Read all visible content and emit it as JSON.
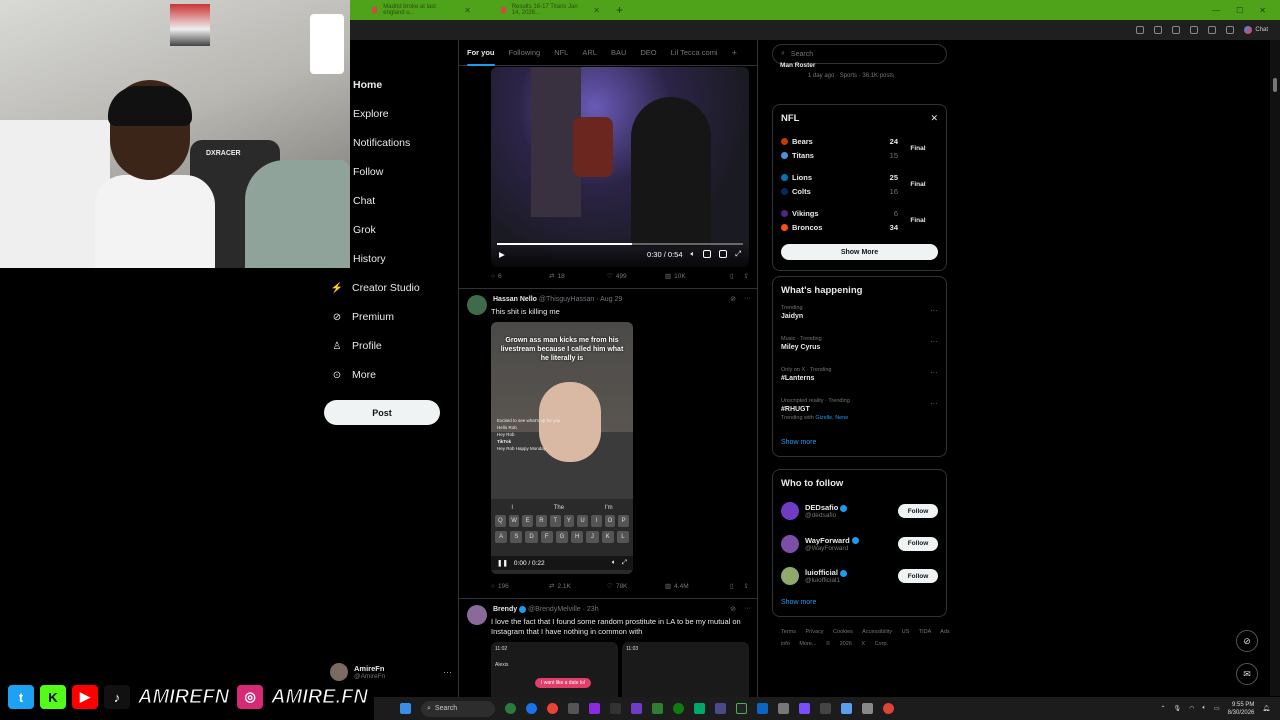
{
  "browser": {
    "tabs": [
      {
        "title": "Madrid broke at last england u..."
      },
      {
        "title": "Results 16-17 Titans Jan 14, 2026..."
      }
    ],
    "new_tab": "+",
    "toolbar_chat": "Chat"
  },
  "overlay": {
    "webcam_chair_text": "DXRACER",
    "social_handle_1": "AMIREFN",
    "social_handle_2": "AMIRE.FN"
  },
  "nav": {
    "items": [
      {
        "label": "Home",
        "icon": "home-icon"
      },
      {
        "label": "Explore",
        "icon": "explore-icon"
      },
      {
        "label": "Notifications",
        "icon": "bell-icon"
      },
      {
        "label": "Follow",
        "icon": "follow-icon"
      },
      {
        "label": "Chat",
        "icon": "chat-icon"
      },
      {
        "label": "Grok",
        "icon": "grok-icon"
      },
      {
        "label": "History",
        "icon": "history-icon"
      },
      {
        "label": "Creator Studio",
        "icon": "creator-studio-icon"
      },
      {
        "label": "Premium",
        "icon": "premium-icon"
      },
      {
        "label": "Profile",
        "icon": "profile-icon"
      },
      {
        "label": "More",
        "icon": "more-icon"
      }
    ],
    "post_button": "Post",
    "account": {
      "name": "AmireFn",
      "handle": "@AmireFn",
      "more": "···"
    }
  },
  "feed": {
    "tabs": [
      "For you",
      "Following",
      "NFL",
      "ARL",
      "BAU",
      "DEO",
      "Lil Tecca comi"
    ],
    "tabs_more": "+",
    "tweet1": {
      "video_time": "0:30 / 0:54",
      "progress": 0.55,
      "replies": "6",
      "reposts": "18",
      "likes": "499",
      "views": "10K"
    },
    "tweet2": {
      "name": "Hassan Nello",
      "handle": "@ThisguyHassan",
      "date": "Aug 29",
      "text": "This shit is killing me",
      "video_caption": "Grown ass man kicks me from his livestream because I called him what he literally is",
      "video_comments": [
        "Excited to see what's up for you",
        "Hello Rob",
        "Hey Rob",
        "TikTok",
        "Hey Rob Happy Monday"
      ],
      "keyboard_suggestions": [
        "I",
        "The",
        "I'm"
      ],
      "keyboard_row1": [
        "Q",
        "W",
        "E",
        "R",
        "T",
        "Y",
        "U",
        "I",
        "O",
        "P"
      ],
      "keyboard_row2": [
        "A",
        "S",
        "D",
        "F",
        "G",
        "H",
        "J",
        "K",
        "L"
      ],
      "video_time": "0:00 / 0:22",
      "replies": "196",
      "reposts": "2.1K",
      "likes": "78K",
      "views": "4.4M"
    },
    "tweet3": {
      "name": "Brendy",
      "handle": "@BrendyMelville",
      "date": "23h",
      "text": "I love the fact that I found some random prostitute in LA to be my mutual on Instagram that I have nothing in common with",
      "media_left_time": "11:02",
      "media_left_name": "Alexis",
      "media_left_pill": "I want like a date lol",
      "media_right_time": "11:03"
    }
  },
  "right": {
    "search_placeholder": "Search",
    "top_strip": {
      "title": "Man Roster",
      "meta": "1 day ago · Sports · 36.1K posts"
    },
    "nfl": {
      "title": "NFL",
      "close": "✕",
      "games": [
        {
          "home": "Bears",
          "home_score": "24",
          "away": "Titans",
          "away_score": "15",
          "status": "Final",
          "home_color": "#c83803",
          "away_color": "#4b92db"
        },
        {
          "home": "Lions",
          "home_score": "25",
          "away": "Colts",
          "away_score": "16",
          "status": "Final",
          "home_color": "#0076b6",
          "away_color": "#002c5f"
        },
        {
          "home": "Vikings",
          "home_score": "6",
          "away": "Broncos",
          "away_score": "34",
          "status": "Final",
          "home_color": "#4f2683",
          "away_color": "#fb4f14"
        }
      ],
      "show_more": "Show More"
    },
    "happening": {
      "title": "What's happening",
      "trends": [
        {
          "context": "Trending",
          "title": "Jaidyn",
          "with": ""
        },
        {
          "context": "Music · Trending",
          "title": "Miley Cyrus",
          "with": ""
        },
        {
          "context": "Only on X · Trending",
          "title": "#Lanterns",
          "with": ""
        },
        {
          "context": "Unscripted reality · Trending",
          "title": "#RHUGT",
          "with_prefix": "Trending with",
          "with": "Gizelle, Nene"
        }
      ],
      "show_more": "Show more"
    },
    "who_to_follow": {
      "title": "Who to follow",
      "accounts": [
        {
          "name": "DEDsafio",
          "handle": "@dedsafio",
          "follow": "Follow",
          "color": "#6f3cc3"
        },
        {
          "name": "WayForward",
          "handle": "@WayForward",
          "follow": "Follow",
          "color": "#7b4fa8"
        },
        {
          "name": "luiofficial",
          "handle": "@luiofficial1",
          "follow": "Follow",
          "color": "#8fa86b"
        }
      ],
      "show_more": "Show more"
    },
    "footer": "Terms Privacy Cookies Accessibility US TIDA Ads info More... © 2026 X Corp."
  },
  "taskbar": {
    "search": "Search",
    "time": "9:55 PM",
    "date": "8/30/2026"
  },
  "colors": {
    "accent": "#1d9bf0",
    "browser_tab_bar": "#4fa31b"
  }
}
